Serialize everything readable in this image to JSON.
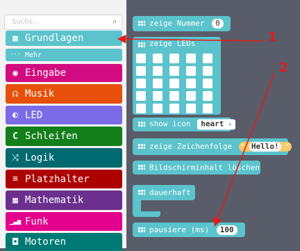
{
  "search": {
    "placeholder": "Suche...",
    "icon": "search-icon"
  },
  "categories": [
    {
      "label": "Grundlagen",
      "icon": "grid-icon",
      "glyph": "▦",
      "color": "#1e90ff"
    },
    {
      "label": "Mehr",
      "icon": "dots-icon",
      "glyph": "···",
      "color": "#1e90ff"
    },
    {
      "label": "Eingabe",
      "icon": "target-icon",
      "glyph": "◉",
      "color": "#d400d4"
    },
    {
      "label": "Musik",
      "icon": "headphones-icon",
      "glyph": "☊",
      "color": "#e63022"
    },
    {
      "label": "LED",
      "icon": "toggle-icon",
      "glyph": "◐",
      "color": "#5c2d91"
    },
    {
      "label": "Schleifen",
      "icon": "loop-icon",
      "glyph": "↻",
      "color": "#107c10"
    },
    {
      "label": "Logik",
      "icon": "shuffle-icon",
      "glyph": "⤨",
      "color": "#006970"
    },
    {
      "label": "Platzhalter",
      "icon": "list-icon",
      "glyph": "≡",
      "color": "#dc143c"
    },
    {
      "label": "Mathematik",
      "icon": "calculator-icon",
      "glyph": "▤",
      "color": "#9400d3"
    },
    {
      "label": "Funk",
      "icon": "signal-icon",
      "glyph": "▁▃▅",
      "color": "#e3008c"
    },
    {
      "label": "Motoren",
      "icon": "car-icon",
      "glyph": "🚗",
      "color": "#008272"
    }
  ],
  "blocks": {
    "show_number": {
      "label": "zeige Nummer",
      "value": "0"
    },
    "show_leds": {
      "label": "zeige LEDs"
    },
    "show_icon": {
      "label": "show icon",
      "value": "heart"
    },
    "show_string": {
      "label": "zeige Zeichenfolge",
      "value": "Hello!",
      "open_quote": "“",
      "close_quote": "”"
    },
    "clear_screen": {
      "label": "Bildschirminhalt löschen"
    },
    "forever": {
      "label": "dauerhaft"
    },
    "pause": {
      "label": "pausiere (ms)",
      "value": "100"
    }
  },
  "annotations": {
    "one": "1",
    "two": "2"
  }
}
